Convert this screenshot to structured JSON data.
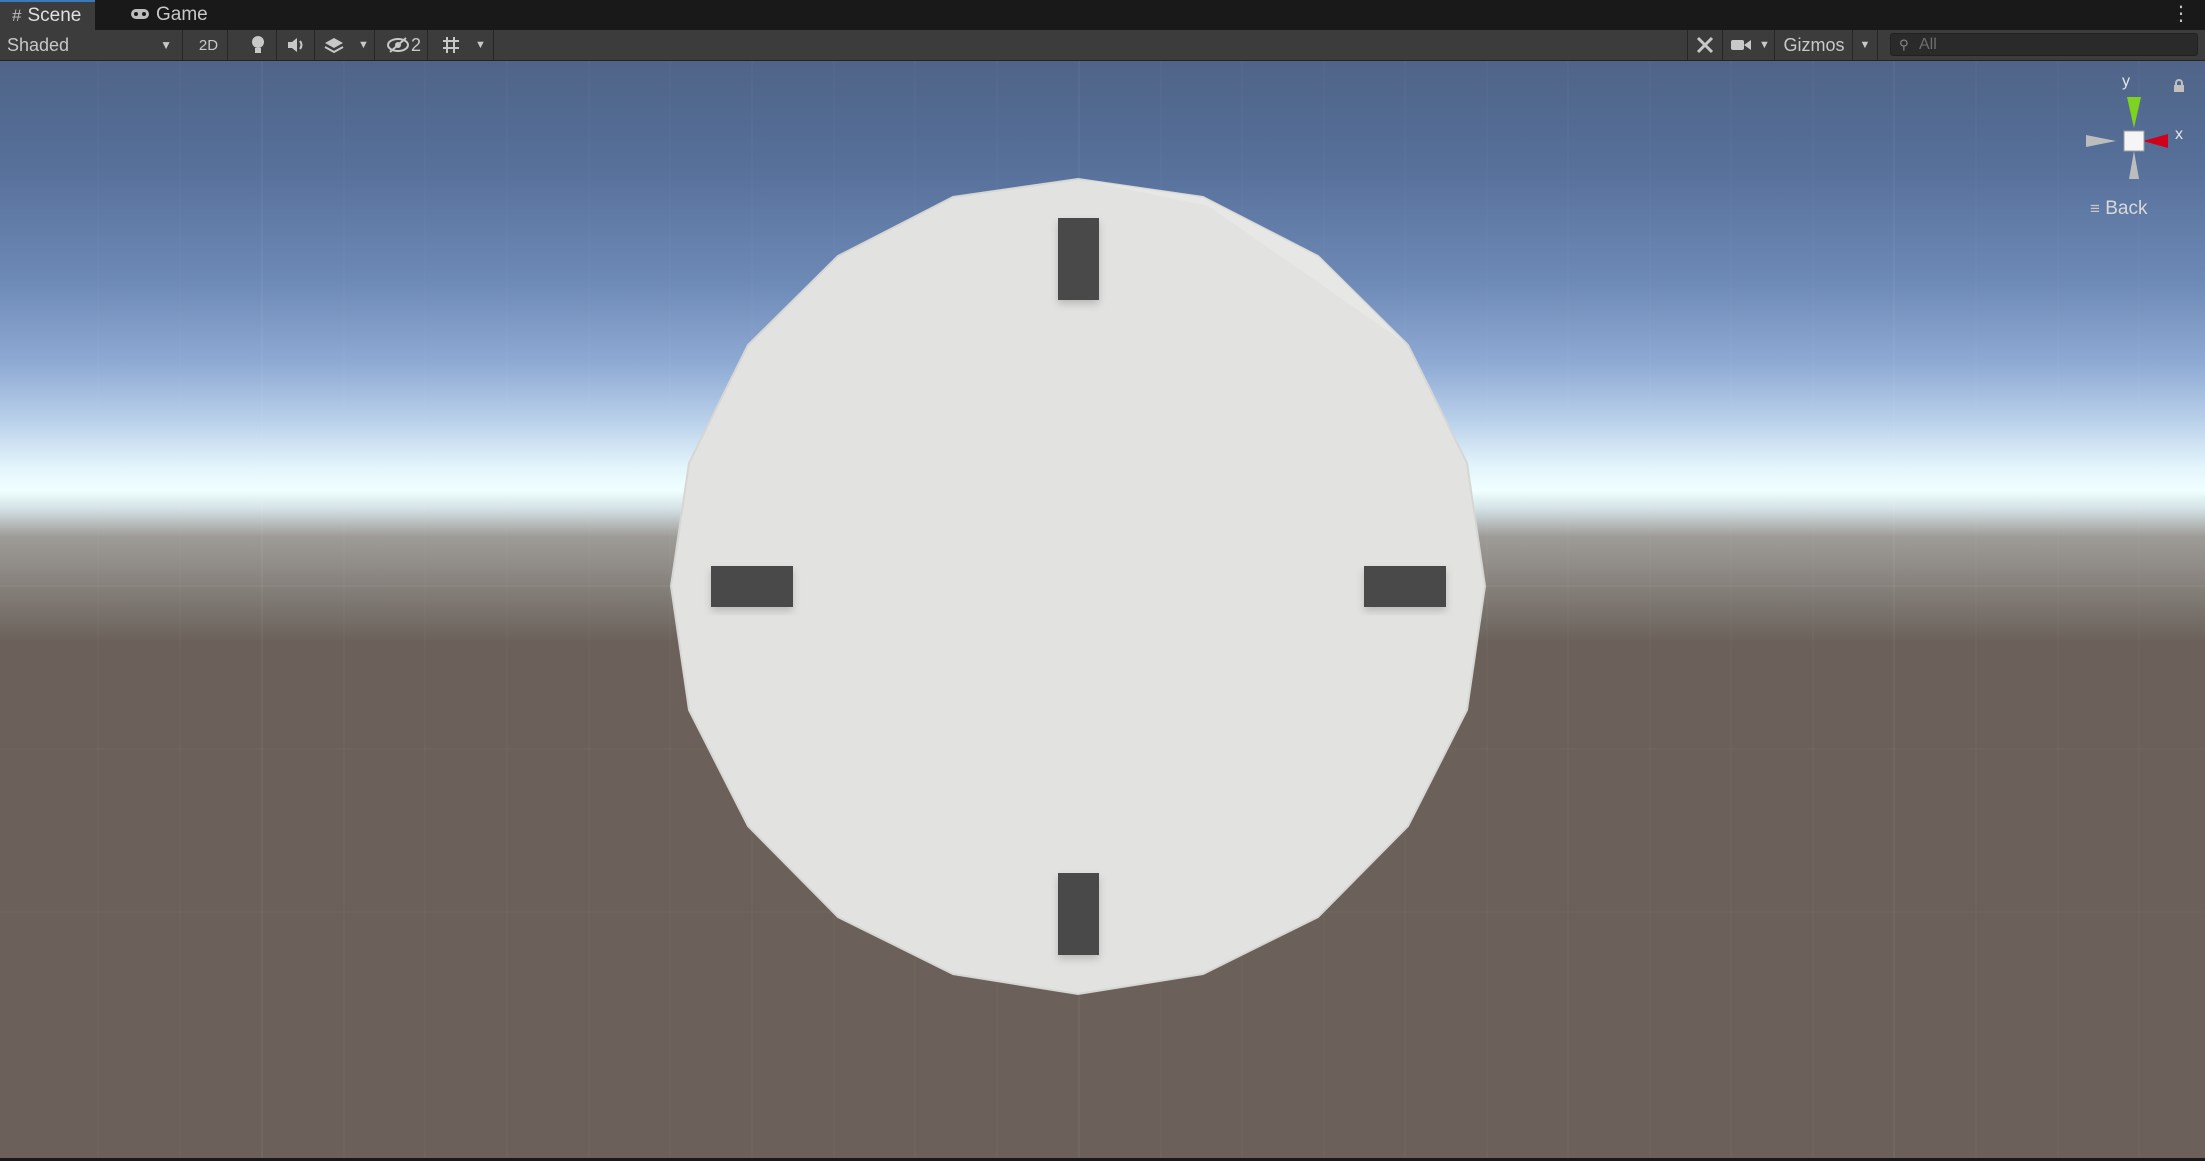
{
  "tabs": [
    {
      "label": "Scene",
      "icon": "grid-hash-icon",
      "active": true
    },
    {
      "label": "Game",
      "icon": "gamepad-icon",
      "active": false
    }
  ],
  "toolbar": {
    "draw_mode": "Shaded",
    "toggle_2d": "2D",
    "hidden_count": "2",
    "gizmos_label": "Gizmos",
    "search_placeholder": "All"
  },
  "gizmo": {
    "y_label": "y",
    "x_label": "x",
    "view_label": "Back"
  },
  "colors": {
    "toolbar_bg": "#3c3c3c",
    "tab_accent": "#3a79bb",
    "clock_face": "#e2e2e0",
    "tick_marks": "#4a4a4a",
    "gizmo_y": "#7ed321",
    "gizmo_x": "#d0021b"
  }
}
